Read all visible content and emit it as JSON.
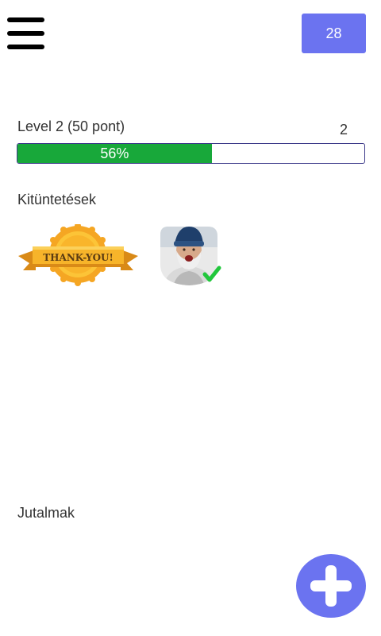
{
  "header": {
    "menu_icon": "hamburger-menu-icon",
    "points_value": "28"
  },
  "level": {
    "label": "Level 2 (50 pont)",
    "count": "2",
    "progress_percent": 56,
    "progress_label": "56%"
  },
  "awards": {
    "title": "Kitüntetések",
    "items": [
      {
        "icon": "thank-you-ribbon-badge",
        "text": "THANK-YOU!"
      },
      {
        "icon": "profile-photo-badge-with-checkmark"
      }
    ]
  },
  "rewards": {
    "title": "Jutalmak"
  },
  "fab": {
    "icon": "plus-icon"
  },
  "colors": {
    "accent": "#6b73f0",
    "progress_green": "#18a83a",
    "progress_border": "#3d3a8a",
    "checkmark_green": "#21c73c",
    "badge_gold": "#f7b42a"
  }
}
